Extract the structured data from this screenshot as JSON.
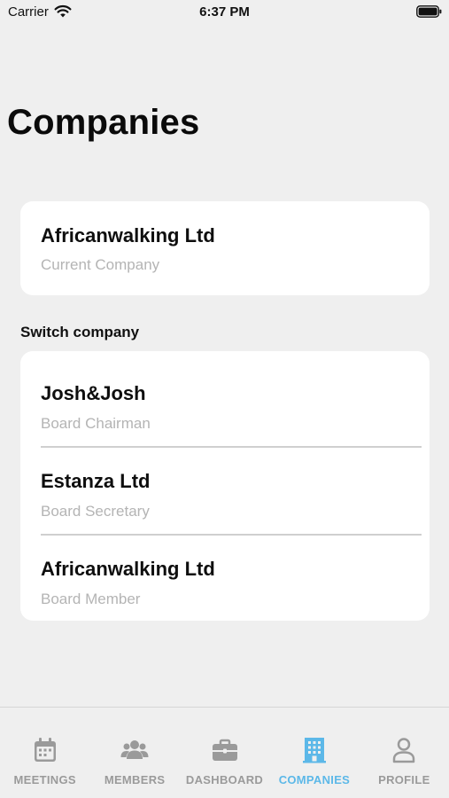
{
  "status_bar": {
    "carrier": "Carrier",
    "time": "6:37 PM"
  },
  "page": {
    "title": "Companies"
  },
  "current_company": {
    "name": "Africanwalking Ltd",
    "label": "Current Company"
  },
  "switch_section": {
    "label": "Switch company",
    "companies": [
      {
        "name": "Josh&Josh",
        "role": "Board Chairman"
      },
      {
        "name": "Estanza Ltd",
        "role": "Board Secretary"
      },
      {
        "name": "Africanwalking Ltd",
        "role": "Board Member"
      }
    ]
  },
  "tab_bar": {
    "active_color": "#5cb8e8",
    "inactive_color": "#9a9a9a",
    "tabs": [
      {
        "label": "MEETINGS",
        "icon": "calendar-icon",
        "active": false
      },
      {
        "label": "MEMBERS",
        "icon": "members-icon",
        "active": false
      },
      {
        "label": "DASHBOARD",
        "icon": "briefcase-icon",
        "active": false
      },
      {
        "label": "COMPANIES",
        "icon": "building-icon",
        "active": true
      },
      {
        "label": "PROFILE",
        "icon": "person-icon",
        "active": false
      }
    ]
  }
}
